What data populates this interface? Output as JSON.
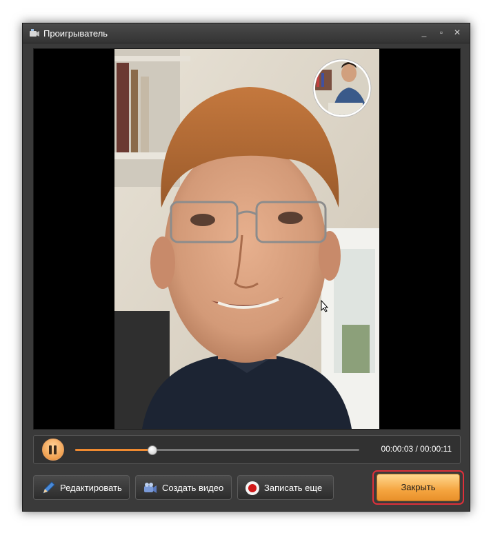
{
  "window": {
    "title": "Проигрыватель",
    "controls": [
      "minimize-icon",
      "maximize-icon",
      "close-icon"
    ]
  },
  "video": {
    "description_icons": [
      "webcam-overlay"
    ]
  },
  "playback": {
    "state_icon": "pause-icon",
    "progress": 0.27,
    "time": "00:00:03 / 00:00:11"
  },
  "buttons": {
    "edit_label": "Редактировать",
    "create_video_label": "Создать видео",
    "record_again_label": "Записать еще",
    "close_label": "Закрыть"
  },
  "colors": {
    "accent": "#f08a30",
    "highlight": "#e0303a",
    "window_bg": "#3a3a3a"
  }
}
